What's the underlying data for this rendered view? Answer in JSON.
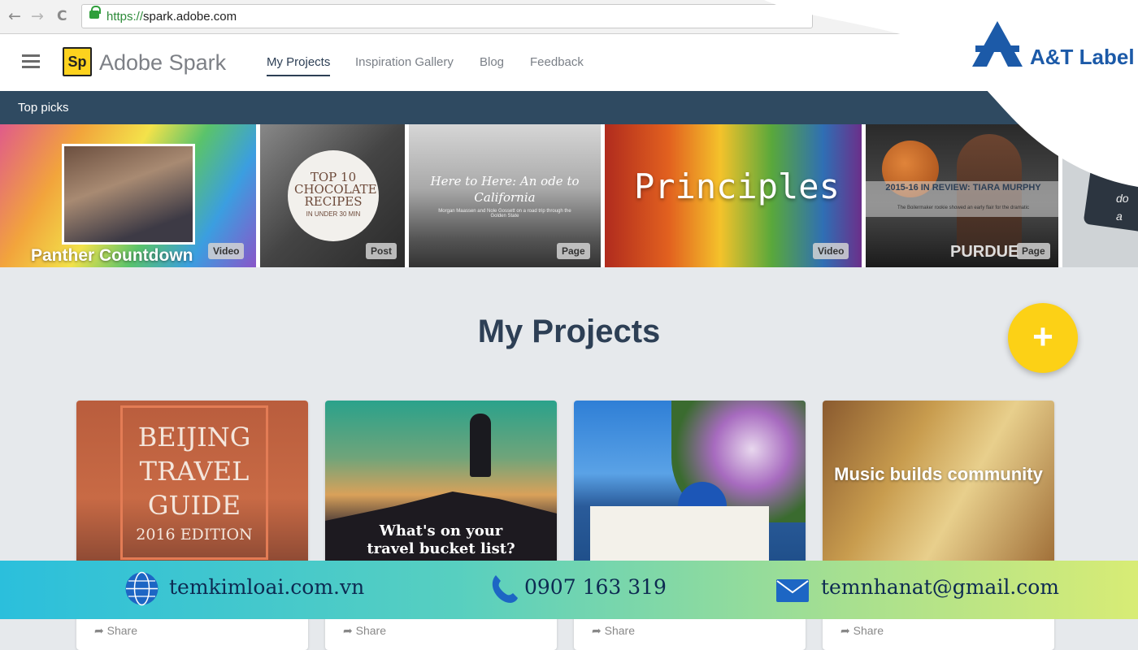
{
  "browser": {
    "back": "←",
    "forward": "→",
    "reload": "C",
    "url_scheme": "https://",
    "url_rest": "spark.adobe.com"
  },
  "header": {
    "logo_mark": "Sp",
    "logo_text": "Adobe Spark",
    "nav": [
      "My Projects",
      "Inspiration Gallery",
      "Blog",
      "Feedback"
    ]
  },
  "brand": {
    "name": "A&T Label"
  },
  "top_picks": {
    "title": "Top picks",
    "cards": [
      {
        "caption": "Panther Countdown",
        "badge": "Video"
      },
      {
        "caption": "TOP 10 CHOCOLATE RECIPES",
        "caption_small": "IN UNDER 30 MIN",
        "badge": "Post"
      },
      {
        "caption": "Here to Here: An ode to California",
        "sub": "Morgan Maassen and Nole Gossett on a road trip through the Golden State",
        "badge": "Page"
      },
      {
        "caption": "Principles",
        "badge": "Video"
      },
      {
        "caption": "2015-16 IN REVIEW: TIARA MURPHY",
        "sub": "The Boilermaker rookie showed an early flair for the dramatic",
        "badge": "Page",
        "jersey": "PURDUE"
      },
      {
        "caption": "do a"
      }
    ]
  },
  "main": {
    "title": "My Projects",
    "fab": "+"
  },
  "projects": [
    {
      "lines": [
        "BEIJING",
        "TRAVEL",
        "GUIDE",
        "2016 EDITION"
      ],
      "share": "Share"
    },
    {
      "lines": [
        "What's on your",
        "travel bucket list?"
      ],
      "share": "Share"
    },
    {
      "lines": [],
      "share": "Share"
    },
    {
      "lines": [
        "Music builds community"
      ],
      "share": "Share"
    }
  ],
  "footer": {
    "website": "temkimloai.com.vn",
    "phone": "0907 163 319",
    "email": "temnhanat@gmail.com"
  },
  "colors": {
    "accent": "#2d3f55",
    "fab": "#fcd116",
    "picks_bar": "#2f4a61"
  }
}
